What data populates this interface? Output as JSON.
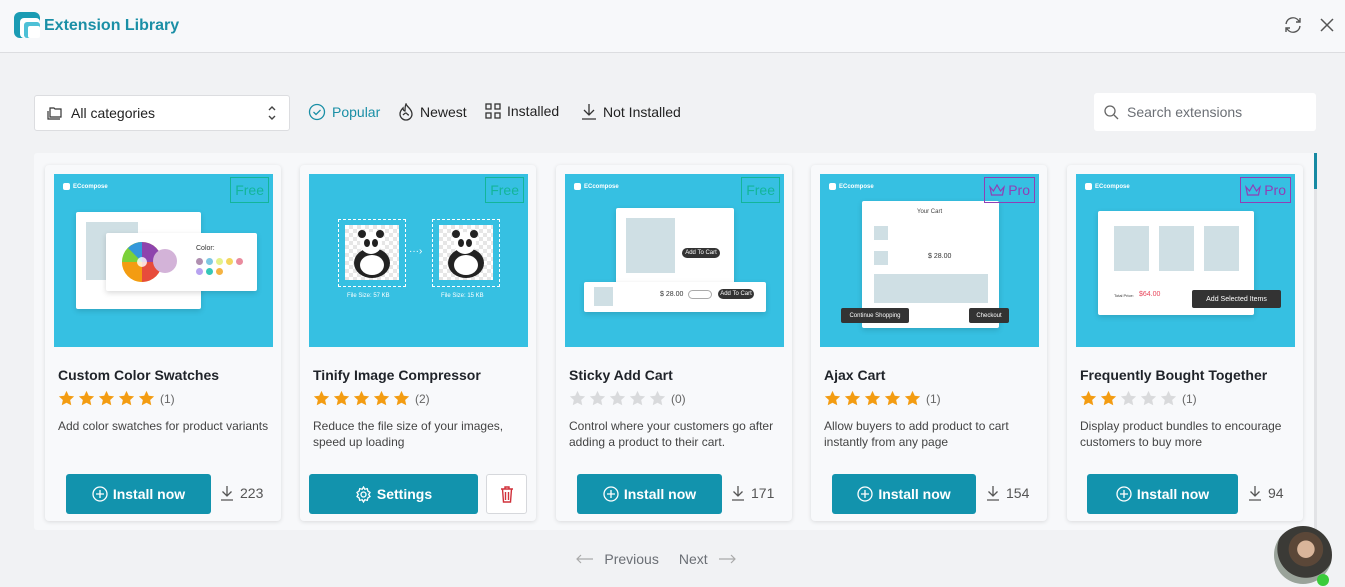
{
  "header": {
    "title": "Extension Library",
    "refresh_icon": "refresh-icon",
    "close_icon": "close-icon"
  },
  "toolbar": {
    "category": {
      "selected": "All categories",
      "icon": "folder-icon"
    },
    "filters": [
      {
        "label": "Popular",
        "icon": "check-circle-icon",
        "active": true
      },
      {
        "label": "Newest",
        "icon": "flame-icon",
        "active": false
      },
      {
        "label": "Installed",
        "icon": "grid-icon",
        "active": false
      },
      {
        "label": "Not Installed",
        "icon": "download-icon",
        "active": false
      }
    ],
    "search": {
      "placeholder": "Search extensions",
      "value": ""
    }
  },
  "colors": {
    "accent": "#1293ad",
    "free_badge": "#13b59a",
    "pro_badge": "#8f3fb6",
    "star_filled": "#f39c12",
    "star_empty": "#d9dadc",
    "thumb_bg": "#36c0e2",
    "delete": "#d0303a"
  },
  "extensions": [
    {
      "title": "Custom Color Swatches",
      "badge": "Free",
      "rating": 5,
      "reviews": "(1)",
      "description": "Add color swatches for product variants",
      "action": "Install now",
      "downloads": "223",
      "thumb": {
        "brand": "ECcompose",
        "label": "Color:"
      }
    },
    {
      "title": "Tinify Image Compressor",
      "badge": "Free",
      "rating": 5,
      "reviews": "(2)",
      "description": "Reduce the file size of your images, speed up loading",
      "action": "Settings",
      "installed": true,
      "thumb": {
        "before": "File Size: 57 KB",
        "after": "File Size: 15 KB"
      }
    },
    {
      "title": "Sticky Add Cart",
      "badge": "Free",
      "rating": 0,
      "reviews": "(0)",
      "description": "Control where your customers go after adding a product to their cart.",
      "action": "Install now",
      "downloads": "171",
      "thumb": {
        "brand": "ECcompose",
        "button": "Add To Cart",
        "price": "$ 28.00"
      }
    },
    {
      "title": "Ajax Cart",
      "badge": "Pro",
      "rating": 5,
      "reviews": "(1)",
      "description": "Allow buyers to add product to cart instantly from any page",
      "action": "Install now",
      "downloads": "154",
      "thumb": {
        "brand": "ECcompose",
        "heading": "Your Cart",
        "price": "$ 28.00",
        "left_button": "Continue Shopping",
        "right_button": "Checkout"
      }
    },
    {
      "title": "Frequently Bought Together",
      "badge": "Pro",
      "rating": 2,
      "reviews": "(1)",
      "description": "Display product bundles to encourage customers to buy more",
      "action": "Install now",
      "downloads": "94",
      "thumb": {
        "brand": "ECcompose",
        "total_label": "Total Price:",
        "total": "$64.00",
        "button": "Add Selected Items"
      }
    }
  ],
  "pagination": {
    "previous": "Previous",
    "next": "Next"
  }
}
